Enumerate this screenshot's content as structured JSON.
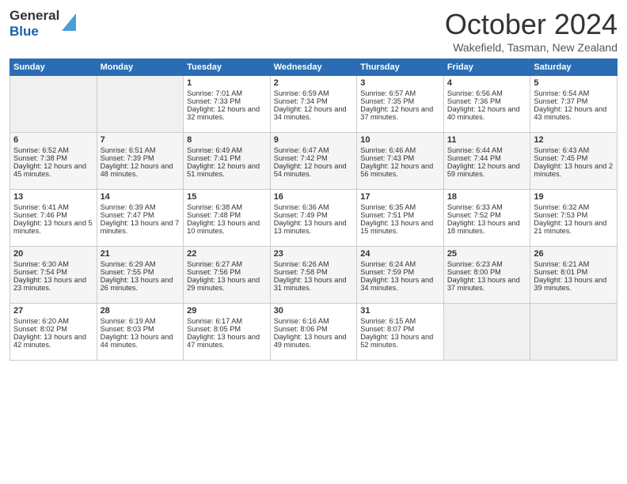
{
  "logo": {
    "line1": "General",
    "line2": "Blue"
  },
  "title": "October 2024",
  "location": "Wakefield, Tasman, New Zealand",
  "days_of_week": [
    "Sunday",
    "Monday",
    "Tuesday",
    "Wednesday",
    "Thursday",
    "Friday",
    "Saturday"
  ],
  "weeks": [
    [
      {
        "day": "",
        "sunrise": "",
        "sunset": "",
        "daylight": ""
      },
      {
        "day": "",
        "sunrise": "",
        "sunset": "",
        "daylight": ""
      },
      {
        "day": "1",
        "sunrise": "Sunrise: 7:01 AM",
        "sunset": "Sunset: 7:33 PM",
        "daylight": "Daylight: 12 hours and 32 minutes."
      },
      {
        "day": "2",
        "sunrise": "Sunrise: 6:59 AM",
        "sunset": "Sunset: 7:34 PM",
        "daylight": "Daylight: 12 hours and 34 minutes."
      },
      {
        "day": "3",
        "sunrise": "Sunrise: 6:57 AM",
        "sunset": "Sunset: 7:35 PM",
        "daylight": "Daylight: 12 hours and 37 minutes."
      },
      {
        "day": "4",
        "sunrise": "Sunrise: 6:56 AM",
        "sunset": "Sunset: 7:36 PM",
        "daylight": "Daylight: 12 hours and 40 minutes."
      },
      {
        "day": "5",
        "sunrise": "Sunrise: 6:54 AM",
        "sunset": "Sunset: 7:37 PM",
        "daylight": "Daylight: 12 hours and 43 minutes."
      }
    ],
    [
      {
        "day": "6",
        "sunrise": "Sunrise: 6:52 AM",
        "sunset": "Sunset: 7:38 PM",
        "daylight": "Daylight: 12 hours and 45 minutes."
      },
      {
        "day": "7",
        "sunrise": "Sunrise: 6:51 AM",
        "sunset": "Sunset: 7:39 PM",
        "daylight": "Daylight: 12 hours and 48 minutes."
      },
      {
        "day": "8",
        "sunrise": "Sunrise: 6:49 AM",
        "sunset": "Sunset: 7:41 PM",
        "daylight": "Daylight: 12 hours and 51 minutes."
      },
      {
        "day": "9",
        "sunrise": "Sunrise: 6:47 AM",
        "sunset": "Sunset: 7:42 PM",
        "daylight": "Daylight: 12 hours and 54 minutes."
      },
      {
        "day": "10",
        "sunrise": "Sunrise: 6:46 AM",
        "sunset": "Sunset: 7:43 PM",
        "daylight": "Daylight: 12 hours and 56 minutes."
      },
      {
        "day": "11",
        "sunrise": "Sunrise: 6:44 AM",
        "sunset": "Sunset: 7:44 PM",
        "daylight": "Daylight: 12 hours and 59 minutes."
      },
      {
        "day": "12",
        "sunrise": "Sunrise: 6:43 AM",
        "sunset": "Sunset: 7:45 PM",
        "daylight": "Daylight: 13 hours and 2 minutes."
      }
    ],
    [
      {
        "day": "13",
        "sunrise": "Sunrise: 6:41 AM",
        "sunset": "Sunset: 7:46 PM",
        "daylight": "Daylight: 13 hours and 5 minutes."
      },
      {
        "day": "14",
        "sunrise": "Sunrise: 6:39 AM",
        "sunset": "Sunset: 7:47 PM",
        "daylight": "Daylight: 13 hours and 7 minutes."
      },
      {
        "day": "15",
        "sunrise": "Sunrise: 6:38 AM",
        "sunset": "Sunset: 7:48 PM",
        "daylight": "Daylight: 13 hours and 10 minutes."
      },
      {
        "day": "16",
        "sunrise": "Sunrise: 6:36 AM",
        "sunset": "Sunset: 7:49 PM",
        "daylight": "Daylight: 13 hours and 13 minutes."
      },
      {
        "day": "17",
        "sunrise": "Sunrise: 6:35 AM",
        "sunset": "Sunset: 7:51 PM",
        "daylight": "Daylight: 13 hours and 15 minutes."
      },
      {
        "day": "18",
        "sunrise": "Sunrise: 6:33 AM",
        "sunset": "Sunset: 7:52 PM",
        "daylight": "Daylight: 13 hours and 18 minutes."
      },
      {
        "day": "19",
        "sunrise": "Sunrise: 6:32 AM",
        "sunset": "Sunset: 7:53 PM",
        "daylight": "Daylight: 13 hours and 21 minutes."
      }
    ],
    [
      {
        "day": "20",
        "sunrise": "Sunrise: 6:30 AM",
        "sunset": "Sunset: 7:54 PM",
        "daylight": "Daylight: 13 hours and 23 minutes."
      },
      {
        "day": "21",
        "sunrise": "Sunrise: 6:29 AM",
        "sunset": "Sunset: 7:55 PM",
        "daylight": "Daylight: 13 hours and 26 minutes."
      },
      {
        "day": "22",
        "sunrise": "Sunrise: 6:27 AM",
        "sunset": "Sunset: 7:56 PM",
        "daylight": "Daylight: 13 hours and 29 minutes."
      },
      {
        "day": "23",
        "sunrise": "Sunrise: 6:26 AM",
        "sunset": "Sunset: 7:58 PM",
        "daylight": "Daylight: 13 hours and 31 minutes."
      },
      {
        "day": "24",
        "sunrise": "Sunrise: 6:24 AM",
        "sunset": "Sunset: 7:59 PM",
        "daylight": "Daylight: 13 hours and 34 minutes."
      },
      {
        "day": "25",
        "sunrise": "Sunrise: 6:23 AM",
        "sunset": "Sunset: 8:00 PM",
        "daylight": "Daylight: 13 hours and 37 minutes."
      },
      {
        "day": "26",
        "sunrise": "Sunrise: 6:21 AM",
        "sunset": "Sunset: 8:01 PM",
        "daylight": "Daylight: 13 hours and 39 minutes."
      }
    ],
    [
      {
        "day": "27",
        "sunrise": "Sunrise: 6:20 AM",
        "sunset": "Sunset: 8:02 PM",
        "daylight": "Daylight: 13 hours and 42 minutes."
      },
      {
        "day": "28",
        "sunrise": "Sunrise: 6:19 AM",
        "sunset": "Sunset: 8:03 PM",
        "daylight": "Daylight: 13 hours and 44 minutes."
      },
      {
        "day": "29",
        "sunrise": "Sunrise: 6:17 AM",
        "sunset": "Sunset: 8:05 PM",
        "daylight": "Daylight: 13 hours and 47 minutes."
      },
      {
        "day": "30",
        "sunrise": "Sunrise: 6:16 AM",
        "sunset": "Sunset: 8:06 PM",
        "daylight": "Daylight: 13 hours and 49 minutes."
      },
      {
        "day": "31",
        "sunrise": "Sunrise: 6:15 AM",
        "sunset": "Sunset: 8:07 PM",
        "daylight": "Daylight: 13 hours and 52 minutes."
      },
      {
        "day": "",
        "sunrise": "",
        "sunset": "",
        "daylight": ""
      },
      {
        "day": "",
        "sunrise": "",
        "sunset": "",
        "daylight": ""
      }
    ]
  ]
}
